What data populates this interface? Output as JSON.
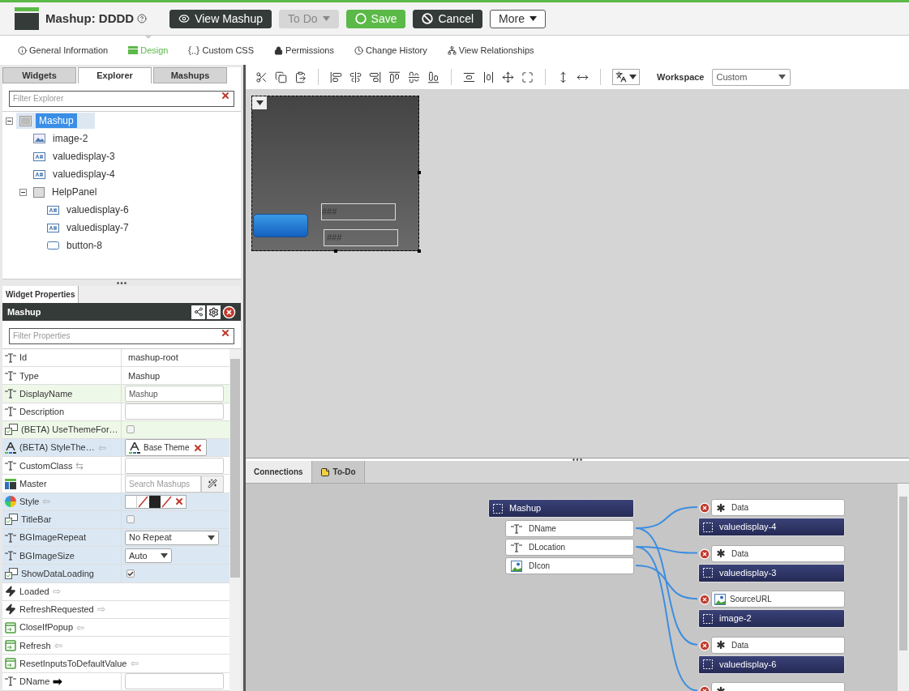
{
  "header": {
    "title": "Mashup: DDDD",
    "buttons": [
      {
        "label": "View Mashup",
        "kind": "view",
        "disabled": false
      },
      {
        "label": "To Do",
        "kind": "menu",
        "disabled": true
      },
      {
        "label": "Save",
        "kind": "save",
        "disabled": false
      },
      {
        "label": "Cancel",
        "kind": "cancel",
        "disabled": false
      },
      {
        "label": "More",
        "kind": "more",
        "disabled": false
      }
    ]
  },
  "nav_tabs": [
    {
      "label": "General Information",
      "selected": false
    },
    {
      "label": "Design",
      "selected": true
    },
    {
      "label": "Custom CSS",
      "selected": false
    },
    {
      "label": "Permissions",
      "selected": false
    },
    {
      "label": "Change History",
      "selected": false
    },
    {
      "label": "View Relationships",
      "selected": false
    }
  ],
  "left_tabs": [
    {
      "label": "Widgets",
      "selected": false
    },
    {
      "label": "Explorer",
      "selected": true
    },
    {
      "label": "Mashups",
      "selected": false
    }
  ],
  "explorer_filter": {
    "placeholder": "Filter Explorer"
  },
  "tree": [
    {
      "label": "Mashup",
      "kind": "mashup",
      "selected": true,
      "expanded": true,
      "children": [
        {
          "label": "image-2",
          "kind": "image",
          "selected": false
        },
        {
          "label": "valuedisplay-3",
          "kind": "value",
          "selected": false
        },
        {
          "label": "valuedisplay-4",
          "kind": "value",
          "selected": false
        },
        {
          "label": "HelpPanel",
          "kind": "panel",
          "selected": false,
          "expanded": true,
          "children": [
            {
              "label": "valuedisplay-6",
              "kind": "value",
              "selected": false
            },
            {
              "label": "valuedisplay-7",
              "kind": "value",
              "selected": false
            },
            {
              "label": "button-8",
              "kind": "button",
              "selected": false
            }
          ]
        }
      ]
    }
  ],
  "properties_tab": "Widget Properties",
  "properties_header": "Mashup",
  "properties_filter": {
    "placeholder": "Filter Properties"
  },
  "properties": [
    {
      "name": "Id",
      "kind": "text",
      "value": "mashup-root",
      "modified": false,
      "highlighted": false
    },
    {
      "name": "Type",
      "kind": "text",
      "value": "Mashup",
      "modified": false,
      "highlighted": false
    },
    {
      "name": "DisplayName",
      "kind": "input",
      "value": "Mashup",
      "modified": true,
      "highlighted": false
    },
    {
      "name": "Description",
      "kind": "input",
      "modified": false,
      "highlighted": false
    },
    {
      "name": "(BETA) UseThemeFor…",
      "kind": "checkbox",
      "checked": false,
      "modified": true,
      "highlighted": false
    },
    {
      "name": "(BETA) StyleThe…",
      "kind": "theme",
      "value": "Base Theme",
      "arrow": "⇦",
      "modified": false,
      "highlighted": true,
      "bound": false
    },
    {
      "name": "CustomClass",
      "kind": "input",
      "arrow": "⇆",
      "modified": false,
      "highlighted": false,
      "bound": false
    },
    {
      "name": "Master",
      "kind": "search",
      "placeholder": "Search Mashups",
      "modified": false,
      "highlighted": false
    },
    {
      "name": "Style",
      "kind": "style",
      "arrow": "⇦",
      "modified": false,
      "highlighted": true,
      "bound": false
    },
    {
      "name": "TitleBar",
      "kind": "checkbox",
      "checked": false,
      "modified": false,
      "highlighted": true
    },
    {
      "name": "BGImageRepeat",
      "kind": "select",
      "value": "No Repeat",
      "modified": false,
      "highlighted": true
    },
    {
      "name": "BGImageSize",
      "kind": "select",
      "value": "Auto",
      "modified": false,
      "highlighted": true
    },
    {
      "name": "ShowDataLoading",
      "kind": "checkbox",
      "checked": true,
      "modified": false,
      "highlighted": true
    },
    {
      "name": "Loaded",
      "kind": "event",
      "arrow": "⇨",
      "modified": false,
      "highlighted": false,
      "bound": false
    },
    {
      "name": "RefreshRequested",
      "kind": "event",
      "arrow": "⇨",
      "modified": false,
      "highlighted": false,
      "bound": false
    },
    {
      "name": "CloseIfPopup",
      "kind": "service",
      "arrow": "⇦",
      "modified": false,
      "highlighted": false,
      "bound": false
    },
    {
      "name": "Refresh",
      "kind": "service",
      "arrow": "⇦",
      "modified": false,
      "highlighted": false,
      "bound": false
    },
    {
      "name": "ResetInputsToDefaultValue",
      "kind": "service",
      "arrow": "⇦",
      "modified": false,
      "highlighted": false,
      "bound": false
    },
    {
      "name": "DName",
      "kind": "input",
      "arrow": "➡",
      "modified": false,
      "highlighted": false,
      "bound": true
    }
  ],
  "workspace": {
    "label": "Workspace",
    "value": "Custom"
  },
  "canvas": {
    "value_displays": [
      "###",
      "###"
    ]
  },
  "bottom_tabs": [
    {
      "label": "Connections",
      "selected": true
    },
    {
      "label": "To-Do",
      "selected": false
    }
  ],
  "connections": {
    "source": "Mashup",
    "params": [
      {
        "name": "DName",
        "kind": "string"
      },
      {
        "name": "DLocation",
        "kind": "string"
      },
      {
        "name": "DIcon",
        "kind": "image"
      }
    ],
    "targets": [
      {
        "param": "Data",
        "kind": "any",
        "widget": "valuedisplay-4"
      },
      {
        "param": "Data",
        "kind": "any",
        "widget": "valuedisplay-3"
      },
      {
        "param": "SourceURL",
        "kind": "image",
        "widget": "image-2"
      },
      {
        "param": "Data",
        "kind": "any",
        "widget": "valuedisplay-6"
      },
      {
        "kind": "any"
      }
    ]
  }
}
